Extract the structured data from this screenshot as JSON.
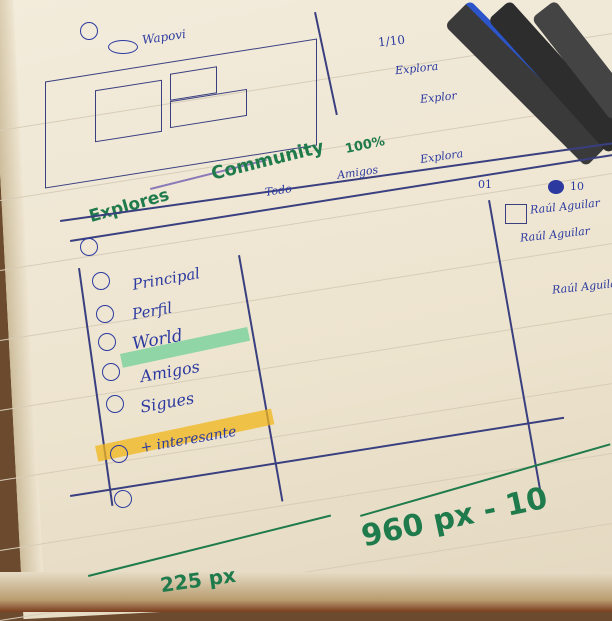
{
  "sketch_top": {
    "logo_label": "Wapovi",
    "status_counter": "1/10",
    "side_links": [
      "Explora",
      "Explor"
    ],
    "tagline_strikethrough": "Explores",
    "tagline": "Community",
    "percent": "100%"
  },
  "nav_tabs": [
    "Todo",
    "Amigos",
    "Explora"
  ],
  "header_counters": {
    "notifications": "01",
    "world": "10"
  },
  "right_panel": {
    "names": [
      "Raúl Aguilar",
      "Raúl Aguilar",
      "Raúl Aguilar"
    ]
  },
  "sidebar": {
    "items": [
      {
        "label": "Principal",
        "icon": "home-icon"
      },
      {
        "label": "Perfil",
        "icon": "user-icon"
      },
      {
        "label": "World",
        "icon": "globe-icon"
      },
      {
        "label": "Amigos",
        "icon": "friends-icon",
        "highlight": "#6fcf97"
      },
      {
        "label": "Sigues",
        "icon": "following-icon"
      },
      {
        "label": "+ interesante",
        "icon": "star-icon",
        "highlight": "#f2b619"
      }
    ]
  },
  "dimensions": {
    "sidebar_width": "225 px",
    "content_width": "960 px - 10"
  },
  "colors": {
    "ink": "#2c3aa0",
    "green_marker": "#1f7a4c",
    "paper": "#f3ecdc"
  }
}
